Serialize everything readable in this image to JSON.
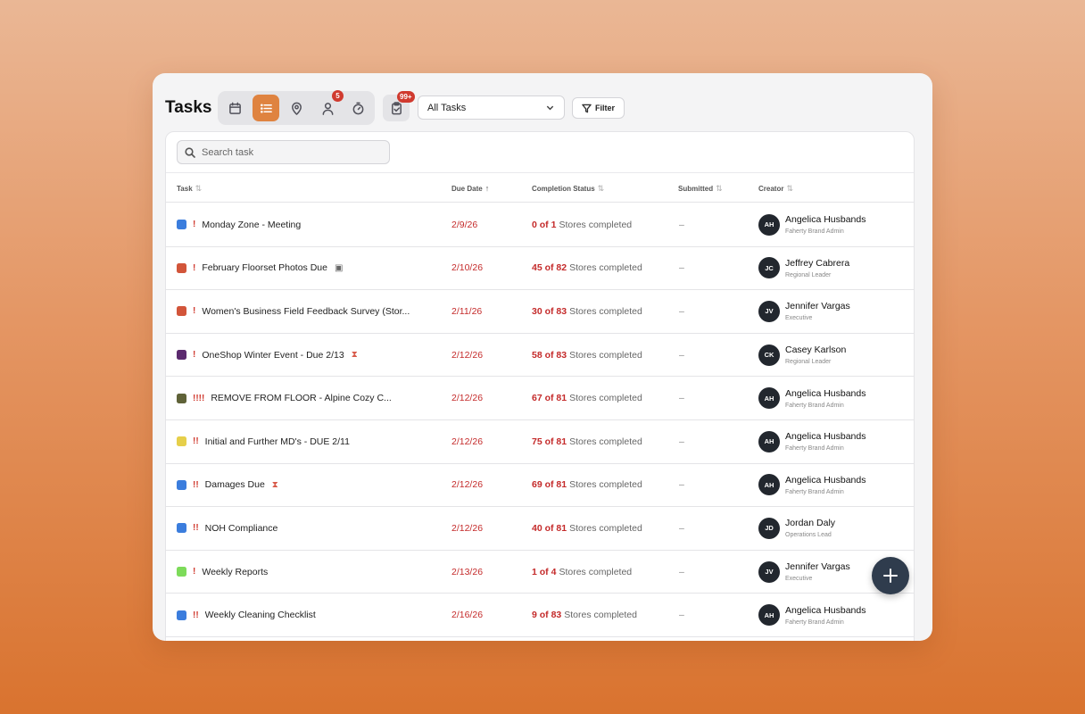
{
  "header": {
    "title": "Tasks",
    "views": [
      {
        "name": "calendar-icon",
        "active": false
      },
      {
        "name": "list-icon",
        "active": true
      },
      {
        "name": "map-pin-icon",
        "active": false
      },
      {
        "name": "user-icon",
        "active": false,
        "badge": "5"
      },
      {
        "name": "timer-icon",
        "active": false
      }
    ],
    "task_badge": "99+",
    "select_value": "All Tasks",
    "filter_label": "Filter"
  },
  "search": {
    "placeholder": "Search task"
  },
  "columns": {
    "task": "Task",
    "due": "Due Date",
    "completion": "Completion Status",
    "submitted": "Submitted",
    "creator": "Creator"
  },
  "rows": [
    {
      "color": "#3b7ddd",
      "priority": "!",
      "name": "Monday Zone - Meeting",
      "icon": "",
      "due": "2/9/26",
      "done": "0 of 1",
      "status_text": "Stores completed",
      "submitted": "–",
      "initials": "AH",
      "creator": "Angelica Husbands",
      "role": "Faherty Brand Admin"
    },
    {
      "color": "#d2553a",
      "priority": "!",
      "name": "February Floorset Photos Due",
      "icon": "clipboard",
      "due": "2/10/26",
      "done": "45 of 82",
      "status_text": "Stores completed",
      "submitted": "–",
      "initials": "JC",
      "creator": "Jeffrey Cabrera",
      "role": "Regional Leader"
    },
    {
      "color": "#d2553a",
      "priority": "!",
      "name": "Women's Business Field Feedback Survey (Stor...",
      "icon": "",
      "due": "2/11/26",
      "done": "30 of 83",
      "status_text": "Stores completed",
      "submitted": "–",
      "initials": "JV",
      "creator": "Jennifer Vargas",
      "role": "Executive"
    },
    {
      "color": "#5b2a6e",
      "priority": "!",
      "name": "OneShop Winter Event - Due 2/13",
      "icon": "hourglass",
      "due": "2/12/26",
      "done": "58 of 83",
      "status_text": "Stores completed",
      "submitted": "–",
      "initials": "CK",
      "creator": "Casey Karlson",
      "role": "Regional Leader"
    },
    {
      "color": "#5f6238",
      "priority": "!!!!",
      "name": "REMOVE FROM FLOOR - Alpine Cozy C...",
      "icon": "",
      "due": "2/12/26",
      "done": "67 of 81",
      "status_text": "Stores completed",
      "submitted": "–",
      "initials": "AH",
      "creator": "Angelica Husbands",
      "role": "Faherty Brand Admin"
    },
    {
      "color": "#e6cf4a",
      "priority": "!!",
      "name": "Initial and Further MD's - DUE 2/11",
      "icon": "",
      "due": "2/12/26",
      "done": "75 of 81",
      "status_text": "Stores completed",
      "submitted": "–",
      "initials": "AH",
      "creator": "Angelica Husbands",
      "role": "Faherty Brand Admin"
    },
    {
      "color": "#3b7ddd",
      "priority": "!!",
      "name": "Damages Due",
      "icon": "hourglass",
      "due": "2/12/26",
      "done": "69 of 81",
      "status_text": "Stores completed",
      "submitted": "–",
      "initials": "AH",
      "creator": "Angelica Husbands",
      "role": "Faherty Brand Admin"
    },
    {
      "color": "#3b7ddd",
      "priority": "!!",
      "name": "NOH Compliance",
      "icon": "",
      "due": "2/12/26",
      "done": "40 of 81",
      "status_text": "Stores completed",
      "submitted": "–",
      "initials": "JD",
      "creator": "Jordan Daly",
      "role": "Operations Lead"
    },
    {
      "color": "#7ddb5a",
      "priority": "!",
      "name": "Weekly Reports",
      "icon": "",
      "due": "2/13/26",
      "done": "1 of 4",
      "status_text": "Stores completed",
      "submitted": "–",
      "initials": "JV",
      "creator": "Jennifer Vargas",
      "role": "Executive"
    },
    {
      "color": "#3b7ddd",
      "priority": "!!",
      "name": "Weekly Cleaning Checklist",
      "icon": "",
      "due": "2/16/26",
      "done": "9 of 83",
      "status_text": "Stores completed",
      "submitted": "–",
      "initials": "AH",
      "creator": "Angelica Husbands",
      "role": "Faherty Brand Admin"
    }
  ],
  "fab": {
    "icon": "plus-icon"
  }
}
